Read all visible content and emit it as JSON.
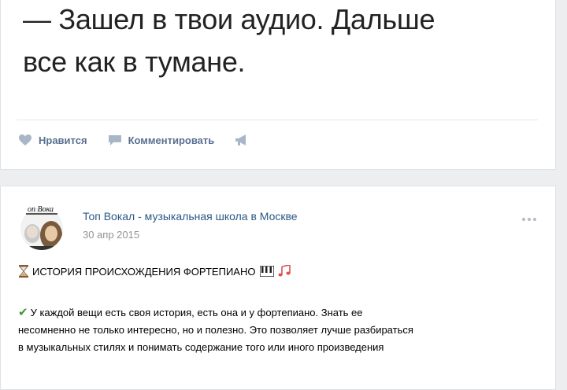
{
  "post1": {
    "quote_line1": "— Зашел в твои аудио. Дальше",
    "quote_line2": "все как в тумане.",
    "like_label": "Нравится",
    "comment_label": "Комментировать"
  },
  "post2": {
    "author": "Топ Вокал - музыкальная школа в Москве",
    "date": "30 апр 2015",
    "title": "ИСТОРИЯ ПРОИСХОЖДЕНИЯ ФОРТЕПИАНО",
    "body_line1": "У каждой вещи есть своя история, есть она и у фортепиано. Знать ее",
    "body_line2": "несомненно не только интересно, но и полезно. Это позволяет лучше разбираться",
    "body_line3": "в музыкальных стилях и понимать содержание того или иного произведения"
  },
  "icons": {
    "like": "heart-icon",
    "comment": "comment-icon",
    "share": "megaphone-icon",
    "hourglass": "hourglass-icon",
    "piano": "piano-keys-icon",
    "notes": "music-notes-icon",
    "check": "check-icon"
  },
  "colors": {
    "background": "#edeef0",
    "card": "#ffffff",
    "link": "#2a5885",
    "action": "#5a7090",
    "muted": "#939393"
  }
}
